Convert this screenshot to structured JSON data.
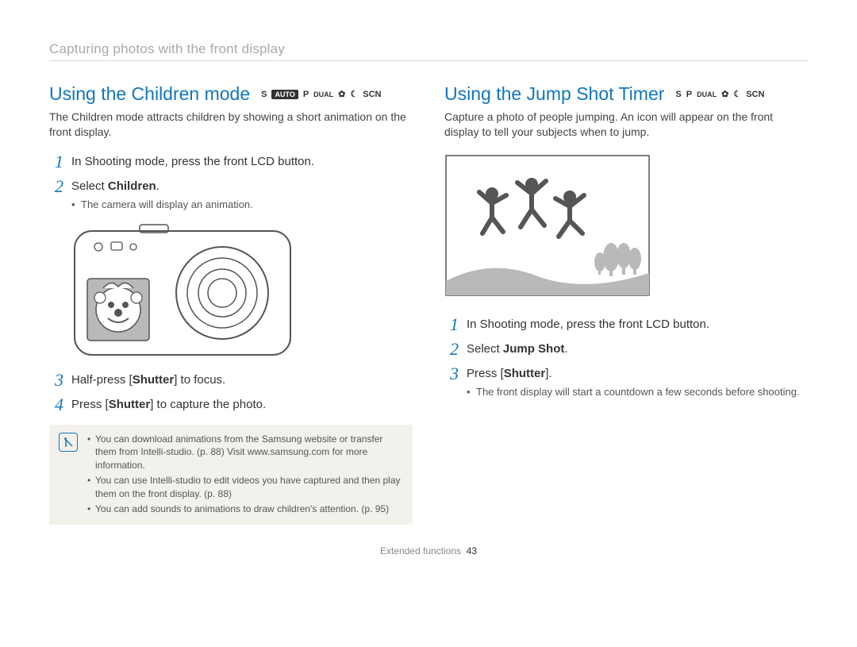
{
  "breadcrumb": "Capturing photos with the front display",
  "left": {
    "title": "Using the Children mode",
    "modes": [
      "S",
      "AUTO",
      "P",
      "DUAL",
      "✿",
      "☾",
      "SCN"
    ],
    "intro": "The Children mode attracts children by showing a short animation on the front display.",
    "steps": [
      {
        "num": "1",
        "text": "In Shooting mode, press the front LCD button."
      },
      {
        "num": "2",
        "text_prefix": "Select ",
        "bold": "Children",
        "text_suffix": ".",
        "sub": [
          "The camera will display an animation."
        ]
      },
      {
        "num": "3",
        "text_prefix": "Half-press [",
        "bold": "Shutter",
        "text_suffix": "] to focus."
      },
      {
        "num": "4",
        "text_prefix": "Press [",
        "bold": "Shutter",
        "text_suffix": "] to capture the photo."
      }
    ],
    "notes": [
      "You can download animations from the Samsung website or transfer them from Intelli-studio. (p. 88) Visit www.samsung.com for more information.",
      "You can use Intelli-studio to edit videos you have captured and then play them on the front display. (p. 88)",
      "You can add sounds to animations to draw children's attention. (p. 95)"
    ]
  },
  "right": {
    "title": "Using the Jump Shot Timer",
    "modes": [
      "S",
      "P",
      "DUAL",
      "✿",
      "☾",
      "SCN"
    ],
    "intro": "Capture a photo of people jumping. An icon will appear on the front display to tell your subjects when to jump.",
    "steps": [
      {
        "num": "1",
        "text": "In Shooting mode, press the front LCD button."
      },
      {
        "num": "2",
        "text_prefix": "Select ",
        "bold": "Jump Shot",
        "text_suffix": "."
      },
      {
        "num": "3",
        "text_prefix": "Press [",
        "bold": "Shutter",
        "text_suffix": "].",
        "sub": [
          "The front display will start a countdown a few seconds before shooting."
        ]
      }
    ]
  },
  "footer": {
    "section": "Extended functions",
    "page": "43"
  }
}
